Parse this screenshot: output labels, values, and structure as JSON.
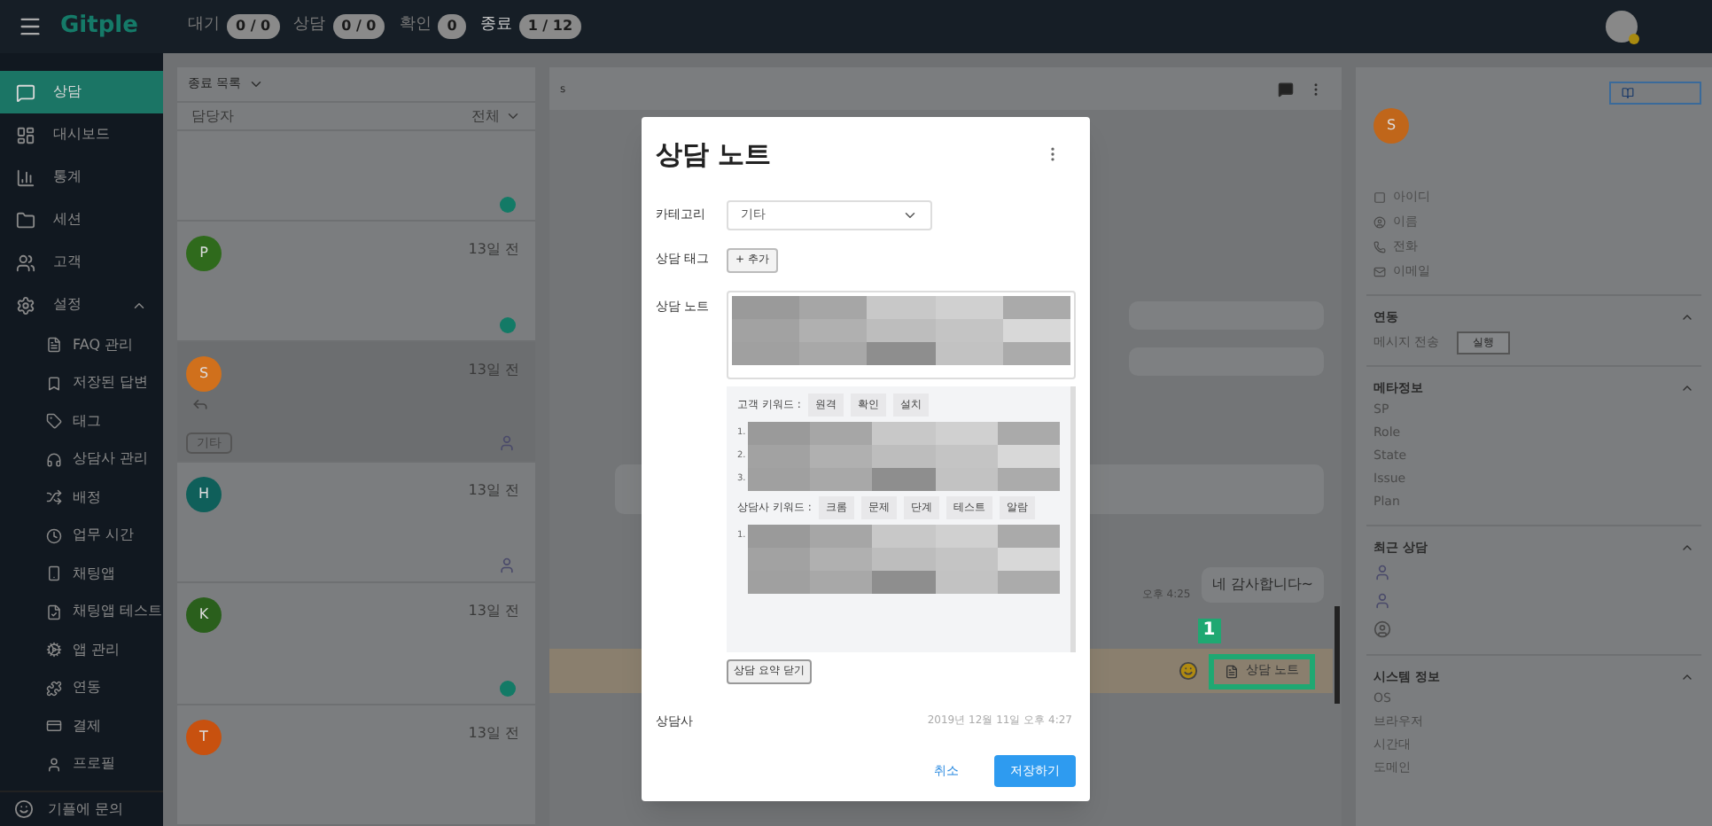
{
  "topbar": {
    "logo": "Gitple",
    "counters": [
      {
        "label": "대기",
        "value": "0 / 0",
        "selected": false
      },
      {
        "label": "상담",
        "value": "0 / 0",
        "selected": false
      },
      {
        "label": "확인",
        "value": "0",
        "selected": false
      },
      {
        "label": "종료",
        "value": "1 / 12",
        "selected": true
      }
    ]
  },
  "sidebar": {
    "items": [
      {
        "label": "상담",
        "selected": true
      },
      {
        "label": "대시보드",
        "selected": false
      },
      {
        "label": "통계",
        "selected": false
      },
      {
        "label": "세션",
        "selected": false
      },
      {
        "label": "고객",
        "selected": false
      },
      {
        "label": "설정",
        "selected": false,
        "expanded": true,
        "children": [
          {
            "label": "FAQ 관리"
          },
          {
            "label": "저장된 답변"
          },
          {
            "label": "태그"
          },
          {
            "label": "상담사 관리"
          },
          {
            "label": "배정"
          },
          {
            "label": "업무 시간"
          },
          {
            "label": "채팅앱"
          },
          {
            "label": "채팅앱 테스트"
          },
          {
            "label": "앱 관리"
          },
          {
            "label": "연동"
          },
          {
            "label": "결제"
          },
          {
            "label": "프로필"
          }
        ]
      }
    ],
    "footer": "기플에 문의"
  },
  "list_panel": {
    "title": "종료 목록",
    "filter_label": "담당자",
    "filter_value": "전체",
    "items": [
      {
        "kind": "done",
        "selected": false
      },
      {
        "initial": "P",
        "color": "#2f6a1c",
        "time": "13일 전",
        "kind": "done",
        "selected": false
      },
      {
        "initial": "S",
        "color": "#d0701c",
        "time": "13일 전",
        "kind": "agent",
        "tag": "기타",
        "selected": true
      },
      {
        "initial": "H",
        "color": "#0f5f5a",
        "time": "13일 전",
        "kind": "agent",
        "selected": false
      },
      {
        "initial": "K",
        "color": "#2a5f1c",
        "time": "13일 전",
        "kind": "done",
        "selected": false
      },
      {
        "initial": "T",
        "color": "#c8510f",
        "time": "13일 전",
        "kind": "none",
        "selected": false
      }
    ]
  },
  "chat": {
    "header": "s",
    "messages": [
      {
        "kind": "short"
      },
      {
        "kind": "short"
      },
      {
        "kind": "long"
      },
      {
        "kind": "text",
        "text": "네 감사합니다~",
        "time": "오후 4:25"
      }
    ],
    "note_button": "상담 노트",
    "highlight_number": "1"
  },
  "customer": {
    "initial": "S",
    "fields": [
      "아이디",
      "이름",
      "전화",
      "이메일"
    ],
    "sections": [
      {
        "title": "연동",
        "expanded": true,
        "kind": "action",
        "label": "메시지 전송",
        "button": "실행"
      },
      {
        "title": "메타정보",
        "expanded": true,
        "kind": "list",
        "items": [
          "SP",
          "Role",
          "State",
          "Issue",
          "Plan"
        ]
      },
      {
        "title": "최근 상담",
        "expanded": true,
        "kind": "avatars",
        "entries": [
          {
            "kind": "agent"
          },
          {
            "kind": "agent"
          },
          {
            "kind": "user"
          }
        ]
      },
      {
        "title": "시스템 정보",
        "expanded": true,
        "kind": "list",
        "items": [
          "OS",
          "브라우저",
          "시간대",
          "도메인"
        ]
      }
    ]
  },
  "modal": {
    "title": "상담 노트",
    "category_label": "카테고리",
    "category_value": "기타",
    "tag_label": "상담 태그",
    "tag_add": "+ 추가",
    "note_label": "상담 노트",
    "customer_keywords_label": "고객 키워드 :",
    "customer_keywords": [
      "원격",
      "확인",
      "설치"
    ],
    "customer_lines": [
      "1.",
      "2.",
      "3."
    ],
    "agent_keywords_label": "상담사 키워드 :",
    "agent_keywords": [
      "크롬",
      "문제",
      "단계",
      "테스트",
      "알람"
    ],
    "agent_lines": [
      "1."
    ],
    "close_summary": "상담 요약 닫기",
    "agent_label": "상담사",
    "date": "2019년 12월 11일 오후 4:27",
    "cancel": "취소",
    "save": "저장하기"
  }
}
